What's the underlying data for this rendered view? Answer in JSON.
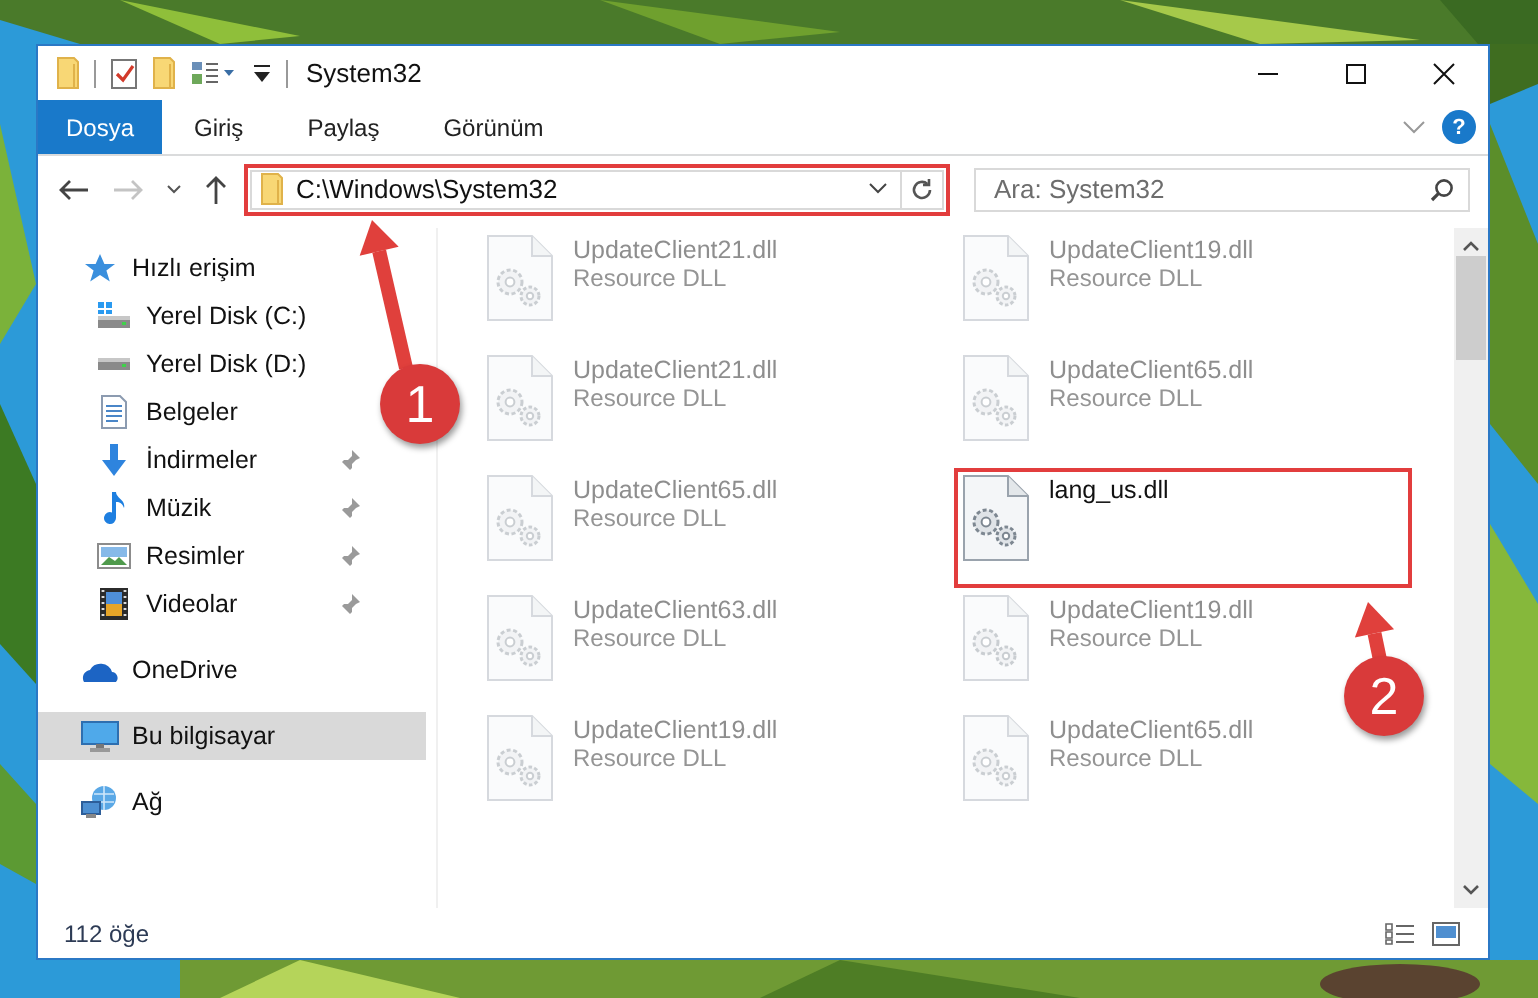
{
  "window": {
    "title": "System32"
  },
  "ribbon": {
    "tabs": [
      {
        "label": "Dosya",
        "selected": true
      },
      {
        "label": "Giriş",
        "selected": false
      },
      {
        "label": "Paylaş",
        "selected": false
      },
      {
        "label": "Görünüm",
        "selected": false
      }
    ],
    "help": "?"
  },
  "address": {
    "path": "C:\\Windows\\System32",
    "highlighted": true
  },
  "search": {
    "placeholder": "Ara: System32"
  },
  "navigation": [
    {
      "label": "Hızlı erişim",
      "selected": false,
      "children": [
        {
          "label": "Yerel Disk (C:)",
          "pinned": false
        },
        {
          "label": "Yerel Disk (D:)",
          "pinned": false
        },
        {
          "label": "Belgeler",
          "pinned": false
        },
        {
          "label": "İndirmeler",
          "pinned": true
        },
        {
          "label": "Müzik",
          "pinned": true
        },
        {
          "label": "Resimler",
          "pinned": true
        },
        {
          "label": "Videolar",
          "pinned": true
        }
      ]
    },
    {
      "label": "OneDrive",
      "selected": false
    },
    {
      "label": "Bu bilgisayar",
      "selected": true
    },
    {
      "label": "Ağ",
      "selected": false
    }
  ],
  "files": [
    {
      "name": "UpdateClient21.dll",
      "type": "Resource DLL",
      "kind": "blurred",
      "highlighted": false
    },
    {
      "name": "UpdateClient19.dll",
      "type": "Resource DLL",
      "kind": "blurred",
      "highlighted": false
    },
    {
      "name": "UpdateClient21.dll",
      "type": "Resource DLL",
      "kind": "blurred",
      "highlighted": false
    },
    {
      "name": "UpdateClient65.dll",
      "type": "Resource DLL",
      "kind": "blurred",
      "highlighted": false
    },
    {
      "name": "UpdateClient65.dll",
      "type": "Resource DLL",
      "kind": "blurred",
      "highlighted": false
    },
    {
      "name": "lang_us.dll",
      "kind": "normal",
      "highlighted": true
    },
    {
      "name": "UpdateClient63.dll",
      "type": "Resource DLL",
      "kind": "blurred",
      "highlighted": false
    },
    {
      "name": "UpdateClient19.dll",
      "type": "Resource DLL",
      "kind": "blurred",
      "highlighted": false
    },
    {
      "name": "UpdateClient19.dll",
      "type": "Resource DLL",
      "kind": "blurred",
      "highlighted": false
    },
    {
      "name": "UpdateClient65.dll",
      "type": "Resource DLL",
      "kind": "blurred",
      "highlighted": false
    }
  ],
  "status_bar": {
    "count": "112 öğe"
  },
  "annotations": [
    {
      "number": "1"
    },
    {
      "number": "2"
    }
  ]
}
